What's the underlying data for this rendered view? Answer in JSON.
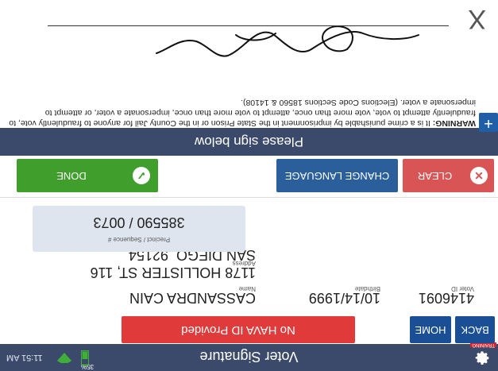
{
  "status_bar": {
    "title": "Voter Signature",
    "training_label": "TRAINING",
    "battery_pct": "35%",
    "clock": "11:51 AM",
    "icons": [
      "gear-icon",
      "battery-icon",
      "wifi-icon"
    ]
  },
  "actions": {
    "back_label": "BACK",
    "home_label": "HOME",
    "no_id_label": "No HAVA ID Provided"
  },
  "voter": {
    "name_label": "Name",
    "name": "CASSANDRA CAIN",
    "birthdate_label": "Birthdate",
    "birthdate": "10/14/1999",
    "voter_id_label": "Voter ID",
    "voter_id": "4146091",
    "address_label": "Address",
    "address_line1": "1178 HOLLISTER ST, 116",
    "address_line2": "SAN DIEGO, 92154",
    "precinct_label": "Precinct / Sequence #",
    "precinct": "385590 / 0073"
  },
  "buttons": {
    "clear_label": "CLEAR",
    "change_language_label": "CHANGE LANGUAGE",
    "done_label": "DONE"
  },
  "sign_prompt": "Please sign below",
  "warning": {
    "prefix": "WARNING:",
    "text": " It is a crime punishable by imprisonment in the State Prison or in the County Jail for anyone to fraudulently vote, to fraudulently attempt to vote, vote more than once, attempt to vote more than once, impersonate a voter, or attempt to impersonate a voter. (Elections Code Sections 18560 & 14108)."
  },
  "signature": {
    "clear_mark": "X"
  },
  "colors": {
    "header": "#3b4a6b",
    "primary_blue": "#1a4f96",
    "no_id_red": "#e03a3a",
    "clear_red": "#d95454",
    "done_green": "#3f9e2c",
    "info_box": "#dfe5ef"
  }
}
